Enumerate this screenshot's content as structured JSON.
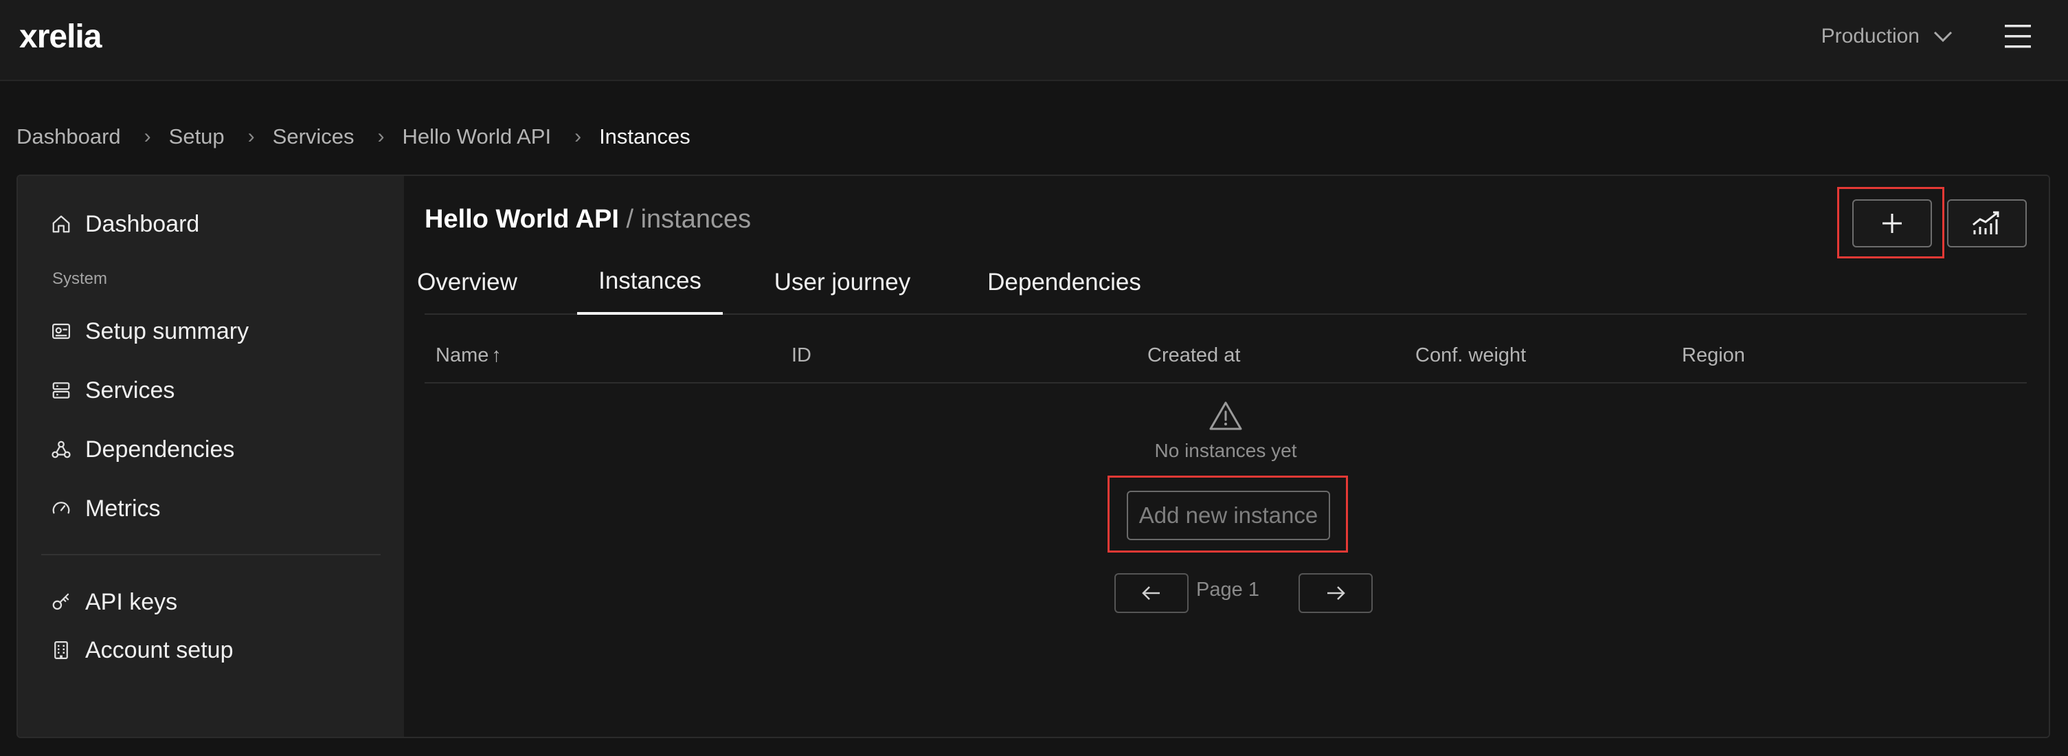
{
  "app": {
    "logo_text": "xrelia"
  },
  "topbar": {
    "environment": "Production",
    "icons": [
      "chevron-down-icon",
      "hamburger-menu-icon"
    ]
  },
  "breadcrumb": [
    {
      "label": "Dashboard"
    },
    {
      "label": "Setup"
    },
    {
      "label": "Services"
    },
    {
      "label": "Hello World API"
    },
    {
      "label": "Instances"
    }
  ],
  "breadcrumb_separator": "›",
  "sidebar": {
    "top_item": {
      "label": "Dashboard",
      "icon": "home-icon"
    },
    "section_label": "System",
    "items": [
      {
        "label": "Setup summary",
        "icon": "setup-summary-icon"
      },
      {
        "label": "Services",
        "icon": "server-icon"
      },
      {
        "label": "Dependencies",
        "icon": "webhook-icon"
      },
      {
        "label": "Metrics",
        "icon": "gauge-icon"
      }
    ],
    "bottom_items": [
      {
        "label": "API keys",
        "icon": "key-icon"
      },
      {
        "label": "Account setup",
        "icon": "building-icon"
      }
    ]
  },
  "main": {
    "title": "Hello World API",
    "subtitle": " / instances",
    "tabs": [
      {
        "label": "Overview"
      },
      {
        "label": "Instances",
        "active": true
      },
      {
        "label": "User journey"
      },
      {
        "label": "Dependencies"
      }
    ],
    "table": {
      "columns": [
        "Name",
        "ID",
        "Created at",
        "Conf. weight",
        "Region"
      ],
      "sort_indicator": "↑",
      "rows": []
    },
    "empty_state": {
      "message": "No instances yet",
      "action_label": "Add new instance",
      "icon": "warning-icon"
    },
    "pagination": {
      "page_label": "Page 1"
    },
    "toolbar_icons": [
      "plus-icon",
      "chart-icon"
    ]
  },
  "colors": {
    "background": "#141414",
    "highlight": "#e53935"
  }
}
